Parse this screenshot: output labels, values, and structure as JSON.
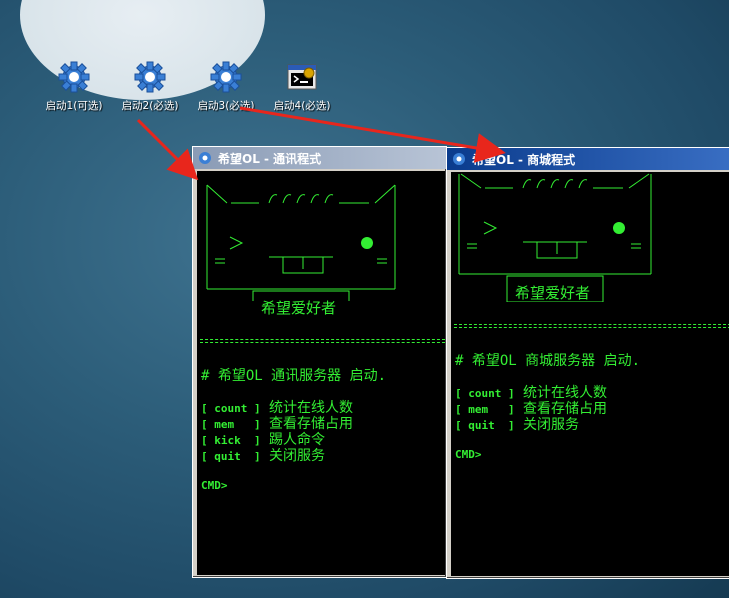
{
  "desktop": {
    "icons": [
      {
        "label": "启动1(可选)"
      },
      {
        "label": "启动2(必选)"
      },
      {
        "label": "启动3(必选)"
      },
      {
        "label": "启动4(必选)"
      }
    ]
  },
  "windows": [
    {
      "title": "希望OL - 通讯程式",
      "mascot_text": "希望爱好者",
      "startup": "# 希望OL 通讯服务器 启动.",
      "commands": [
        {
          "cmd": "[ count ]",
          "desc": "统计在线人数"
        },
        {
          "cmd": "[ mem   ]",
          "desc": "查看存储占用"
        },
        {
          "cmd": "[ kick  ]",
          "desc": "踢人命令"
        },
        {
          "cmd": "[ quit  ]",
          "desc": "关闭服务"
        }
      ],
      "prompt": "CMD>"
    },
    {
      "title": "希望OL - 商城程式",
      "mascot_text": "希望爱好者",
      "startup": "# 希望OL 商城服务器 启动.",
      "commands": [
        {
          "cmd": "[ count ]",
          "desc": "统计在线人数"
        },
        {
          "cmd": "[ mem   ]",
          "desc": "查看存储占用"
        },
        {
          "cmd": "[ quit  ]",
          "desc": "关闭服务"
        }
      ],
      "prompt": "CMD>"
    }
  ],
  "colors": {
    "console_text": "#33ee33",
    "arrow": "#e8261c"
  }
}
